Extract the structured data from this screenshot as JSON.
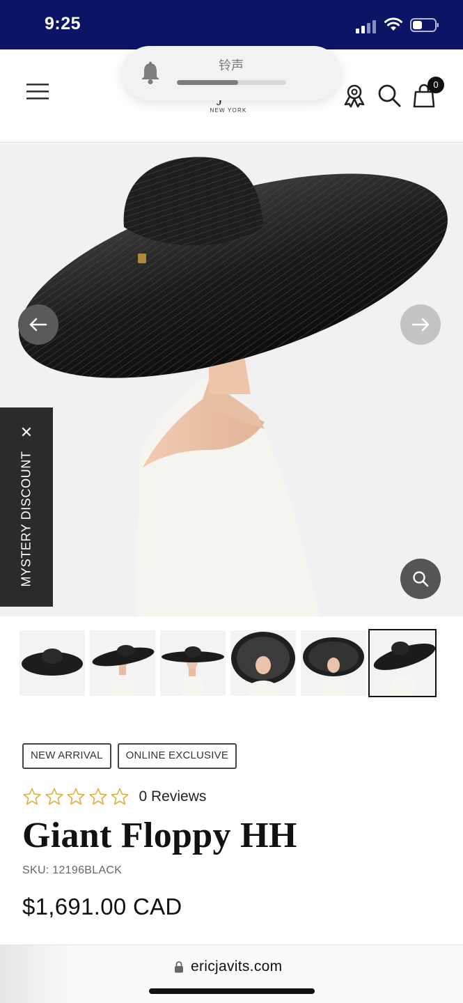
{
  "status_bar": {
    "time": "9:25"
  },
  "header": {
    "logo_subtitle": "NEW YORK",
    "logo_partial_glyph": "J",
    "cart_count": "0"
  },
  "ringer": {
    "label": "铃声",
    "level": 0.56
  },
  "gallery": {
    "prev_label": "previous image",
    "next_label": "next image"
  },
  "mystery_discount": {
    "label": "MYSTERY DISCOUNT",
    "close_glyph": "✕"
  },
  "thumbnails": {
    "count": 6,
    "active_index": 5
  },
  "product": {
    "badges": [
      "NEW ARRIVAL",
      "ONLINE EXCLUSIVE"
    ],
    "rating": 0,
    "max_rating": 5,
    "reviews_label": "0 Reviews",
    "title": "Giant Floppy HH",
    "sku": "SKU: 12196BLACK",
    "price": "$1,691.00 CAD"
  },
  "browser": {
    "url": "ericjavits.com"
  },
  "colors": {
    "status_bar_bg": "#0c1466",
    "star_outline": "#d8b23a",
    "mystery_tab_bg": "#2b2b2b"
  }
}
